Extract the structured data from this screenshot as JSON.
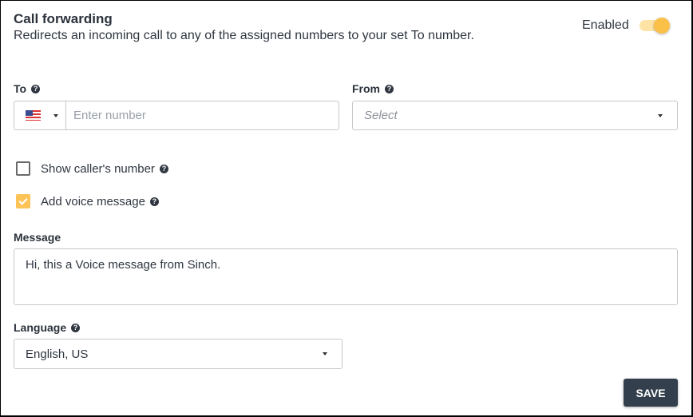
{
  "header": {
    "title": "Call forwarding",
    "subtitle": "Redirects an incoming call to any of the assigned numbers to your set To number.",
    "toggle_label": "Enabled",
    "toggle_on": true
  },
  "to_field": {
    "label": "To",
    "help_icon": "question-circle-icon",
    "country_flag": "us-flag-icon",
    "placeholder": "Enter number",
    "value": ""
  },
  "from_field": {
    "label": "From",
    "help_icon": "question-circle-icon",
    "placeholder": "Select"
  },
  "options": {
    "show_callers_number": {
      "label": "Show caller's number",
      "checked": false
    },
    "add_voice_message": {
      "label": "Add voice message",
      "checked": true
    }
  },
  "message_field": {
    "label": "Message",
    "value": "Hi, this a Voice message from Sinch."
  },
  "language_field": {
    "label": "Language",
    "value": "English, US"
  },
  "actions": {
    "save_label": "SAVE"
  },
  "colors": {
    "accent": "#fbc047",
    "button": "#333f4d",
    "text": "#2f3640"
  }
}
